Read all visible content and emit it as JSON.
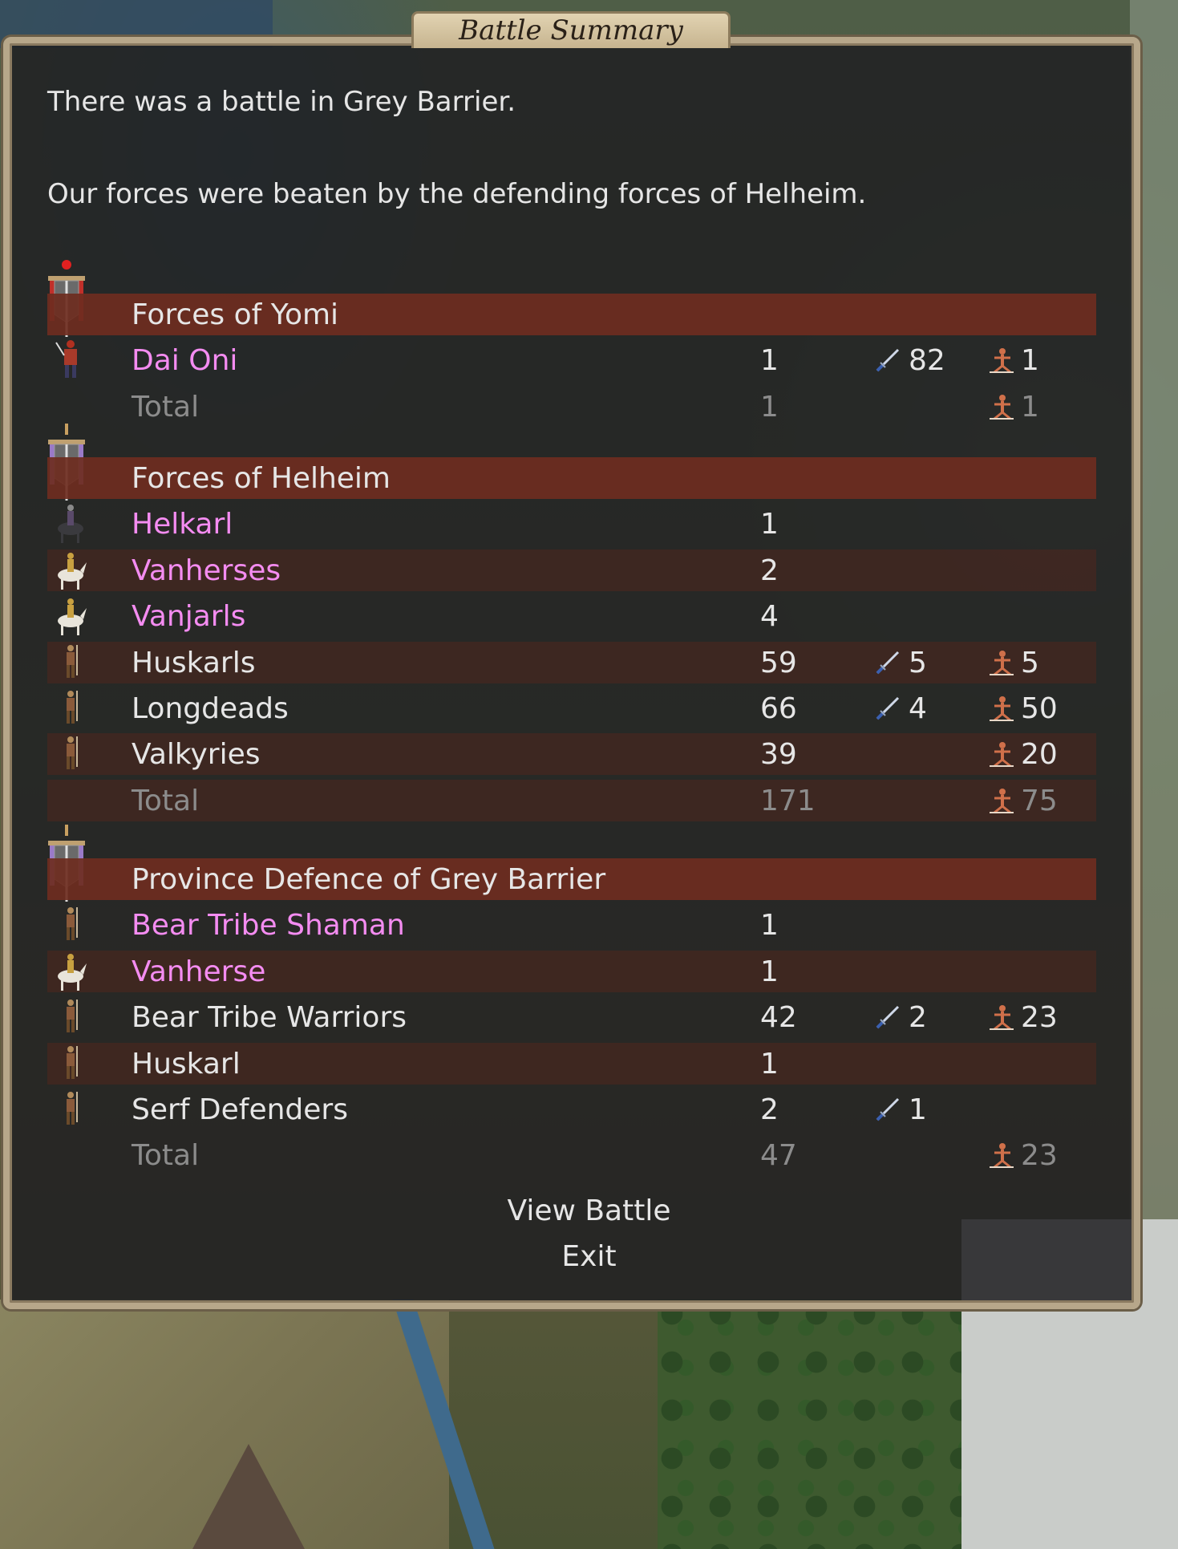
{
  "window": {
    "title": "Battle Summary"
  },
  "messages": {
    "battle_location": "There was a battle in Grey Barrier.",
    "result": "Our forces were beaten by the defending forces of Helheim."
  },
  "icons": {
    "kills": "sword-icon",
    "losses": "fallen-soldier-icon"
  },
  "colors": {
    "commander_name": "#f48cf1",
    "header_band": "#6e2d20",
    "total_text": "#8c8c8c",
    "yomi_banner": "#c0302a",
    "helheim_banner": "#9a7ac8"
  },
  "sides": [
    {
      "name": "Forces of Yomi",
      "banner_icon": "red-banner-icon",
      "units": [
        {
          "name": "Dai Oni",
          "commander": true,
          "count": "1",
          "kills": "82",
          "losses": "1",
          "icon": "samurai-icon"
        }
      ],
      "total": {
        "label": "Total",
        "count": "1",
        "losses": "1"
      }
    },
    {
      "name": "Forces of Helheim",
      "banner_icon": "purple-banner-icon",
      "units": [
        {
          "name": "Helkarl",
          "commander": true,
          "count": "1",
          "kills": "",
          "losses": "",
          "icon": "dark-rider-icon"
        },
        {
          "name": "Vanherses",
          "commander": true,
          "count": "2",
          "kills": "",
          "losses": "",
          "icon": "white-horse-rider-icon"
        },
        {
          "name": "Vanjarls",
          "commander": true,
          "count": "4",
          "kills": "",
          "losses": "",
          "icon": "white-horse-rider-icon"
        },
        {
          "name": "Huskarls",
          "commander": false,
          "count": "59",
          "kills": "5",
          "losses": "5",
          "icon": "warrior-icon"
        },
        {
          "name": "Longdeads",
          "commander": false,
          "count": "66",
          "kills": "4",
          "losses": "50",
          "icon": "archer-icon"
        },
        {
          "name": "Valkyries",
          "commander": false,
          "count": "39",
          "kills": "",
          "losses": "20",
          "icon": "valkyrie-icon"
        }
      ],
      "total": {
        "label": "Total",
        "count": "171",
        "losses": "75"
      }
    },
    {
      "name": "Province Defence of Grey Barrier",
      "banner_icon": "purple-banner-icon",
      "units": [
        {
          "name": "Bear Tribe Shaman",
          "commander": true,
          "count": "1",
          "kills": "",
          "losses": "",
          "icon": "shaman-icon"
        },
        {
          "name": "Vanherse",
          "commander": true,
          "count": "1",
          "kills": "",
          "losses": "",
          "icon": "white-horse-rider-icon"
        },
        {
          "name": "Bear Tribe Warriors",
          "commander": false,
          "count": "42",
          "kills": "2",
          "losses": "23",
          "icon": "warrior-icon"
        },
        {
          "name": "Huskarl",
          "commander": false,
          "count": "1",
          "kills": "",
          "losses": "",
          "icon": "warrior-icon"
        },
        {
          "name": "Serf Defenders",
          "commander": false,
          "count": "2",
          "kills": "1",
          "losses": "",
          "icon": "serf-icon"
        }
      ],
      "total": {
        "label": "Total",
        "count": "47",
        "losses": "23"
      }
    }
  ],
  "buttons": {
    "view_battle": "View Battle",
    "exit": "Exit"
  }
}
